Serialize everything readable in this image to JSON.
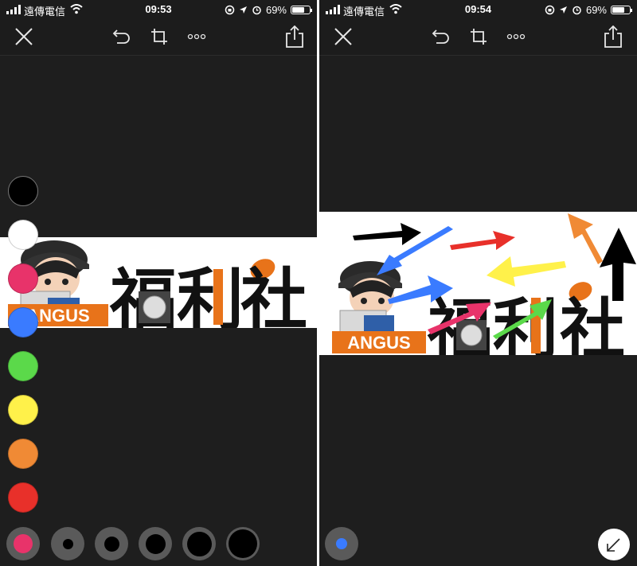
{
  "status_left": {
    "carrier": "遠傳電信",
    "time": "09:53",
    "battery": "69%",
    "battery_level": 0.69
  },
  "status_right": {
    "carrier": "遠傳電信",
    "time": "09:54",
    "battery": "69%",
    "battery_level": 0.69
  },
  "toolbar_icons": [
    "close-icon",
    "undo-icon",
    "crop-icon",
    "more-icon",
    "share-icon"
  ],
  "banner": {
    "brand": "ANGUS",
    "title_chars": [
      "福",
      "利",
      "社"
    ],
    "accent": "#e8731a"
  },
  "palette": [
    {
      "name": "black",
      "color": "#000000"
    },
    {
      "name": "white",
      "color": "#ffffff"
    },
    {
      "name": "pink",
      "color": "#e8336a"
    },
    {
      "name": "blue",
      "color": "#3a7bff"
    },
    {
      "name": "green",
      "color": "#5bd94a"
    },
    {
      "name": "yellow",
      "color": "#fff14a"
    },
    {
      "name": "orange",
      "color": "#f08a35"
    },
    {
      "name": "red",
      "color": "#e8302a"
    }
  ],
  "stroke_sizes": [
    1,
    2,
    3,
    4,
    5
  ],
  "selected_stroke_color": "#e8336a",
  "selected_tool_color": "#3a7bff",
  "arrow_colors": [
    "#000000",
    "#3a7bff",
    "#e8302a",
    "#f08a35",
    "#fff14a",
    "#5bd94a",
    "#e8336a"
  ]
}
